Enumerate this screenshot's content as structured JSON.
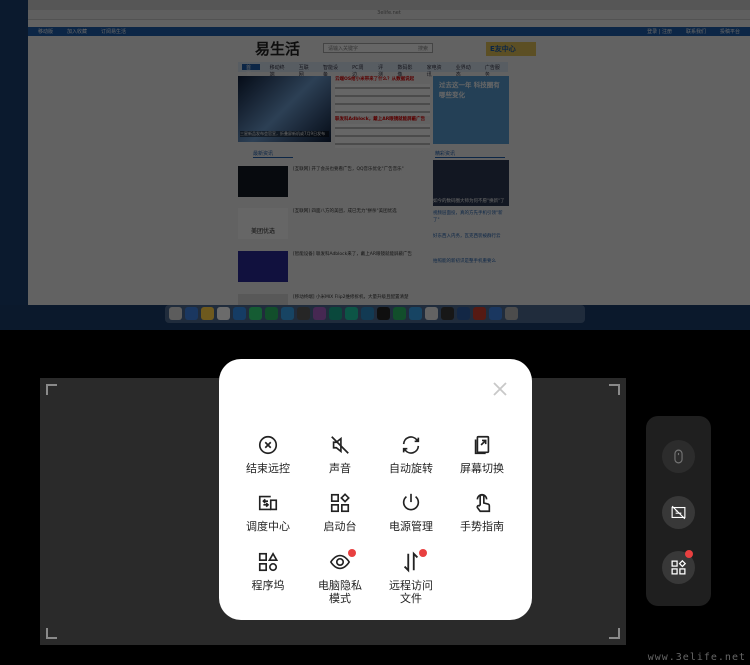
{
  "browser": {
    "domain": "3elife.net",
    "top_nav": [
      "移动版",
      "加入收藏",
      "订阅易生活"
    ],
    "top_right": [
      "登录 | 注册",
      "联系我们",
      "投稿平台"
    ],
    "logo": "易生活",
    "search_placeholder": "请输入关键字",
    "search_button": "搜索",
    "ebox": "E友中心",
    "menu": [
      "首页",
      "移动终端",
      "互联网",
      "智能设备",
      "PC周边",
      "评测",
      "数码影像",
      "家电资讯",
      "业界动态",
      "广告服务"
    ],
    "banner_caption": "三星新品发布会官宣，折叠屏新机或7月9日发布",
    "headlines": [
      "云端OS给小米带来了什么？从数据说起",
      "联发科Adblock，戴上AR眼镜就能屏蔽广告"
    ],
    "ad_text": "过去这一年 科技圈有哪些变化",
    "section_latest": "最新资讯",
    "section_featured": "精彩资讯",
    "news": [
      "[互联网] 开了会员也要看广告，QQ音乐优化\"广告音乐\"",
      "[互联网] 四面八方的美团，成已无力\"拼杀\"美团优选",
      "[智能设备] 联发科Adblock来了，戴上AR眼镜就能屏蔽广告",
      "[移动终端] 小米MIX Flip2维修拆机，大量升级且配置清楚"
    ],
    "meituan_logo": "美团优选",
    "side_items": [
      "如今的数码圈大师为何不愿\"换新\"了",
      "视频层面投，真的方先手机引领\"新了\"",
      "好东西入内务，瓦克西装被群行云",
      "拍照能的新初识是整手机重要么"
    ]
  },
  "modal": {
    "items": [
      {
        "icon": "close-circle-icon",
        "label": "结束远控"
      },
      {
        "icon": "sound-off-icon",
        "label": "声音"
      },
      {
        "icon": "auto-rotate-icon",
        "label": "自动旋转"
      },
      {
        "icon": "screen-switch-icon",
        "label": "屏幕切换"
      },
      {
        "icon": "mission-control-icon",
        "label": "调度中心"
      },
      {
        "icon": "launchpad-icon",
        "label": "启动台"
      },
      {
        "icon": "power-icon",
        "label": "电源管理"
      },
      {
        "icon": "gesture-icon",
        "label": "手势指南"
      },
      {
        "icon": "dock-icon",
        "label": "程序坞"
      },
      {
        "icon": "eye-icon",
        "label": "电脑隐私\n模式",
        "badge": true
      },
      {
        "icon": "file-transfer-icon",
        "label": "远程访问\n文件",
        "badge": true
      }
    ]
  },
  "colors": {
    "badge": "#e84040",
    "accent": "#1d5fb0"
  },
  "watermark": "www.3elife.net"
}
